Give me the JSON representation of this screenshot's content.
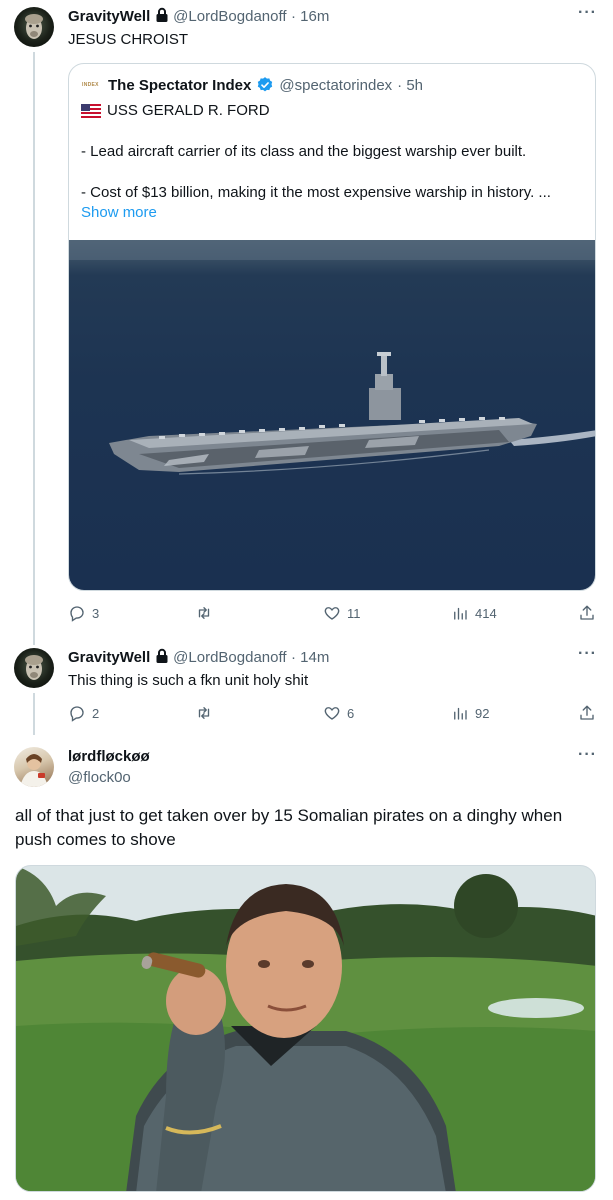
{
  "tweet1": {
    "name": "GravityWell",
    "handle": "@LordBogdanoff",
    "time": "· 16m",
    "text": "JESUS CHROIST",
    "quote": {
      "logo_text": "INDEX",
      "name": "The Spectator Index",
      "handle": "@spectatorindex",
      "time": "· 5h",
      "line1": "USS GERALD R. FORD",
      "line2": "- Lead aircraft carrier of its class and the biggest warship ever built.",
      "line3": "- Cost of $13 billion, making it the most expensive warship in history. ...",
      "show_more": "Show more"
    },
    "actions": {
      "replies": "3",
      "reposts": "",
      "likes": "11",
      "views": "414"
    }
  },
  "tweet2": {
    "name": "GravityWell",
    "handle": "@LordBogdanoff",
    "time": "· 14m",
    "text": "This thing is such a fkn unit holy shit",
    "actions": {
      "replies": "2",
      "reposts": "",
      "likes": "6",
      "views": "92"
    }
  },
  "tweet3": {
    "name": "lørdfløckøø",
    "handle": "@flock0o",
    "text": "all of that just to get taken over by 15 Somalian pirates on a dinghy when push comes to shove"
  },
  "icons": {
    "reply": "reply-icon",
    "repost": "repost-icon",
    "like": "heart-icon",
    "views": "views-icon",
    "share": "share-icon",
    "lock": "lock-icon",
    "verified": "verified-badge-icon",
    "flag": "us-flag-icon",
    "more": "more-icon"
  },
  "colors": {
    "accent": "#1d9bf0",
    "secondary_text": "#536471",
    "border": "#cfd9de"
  }
}
